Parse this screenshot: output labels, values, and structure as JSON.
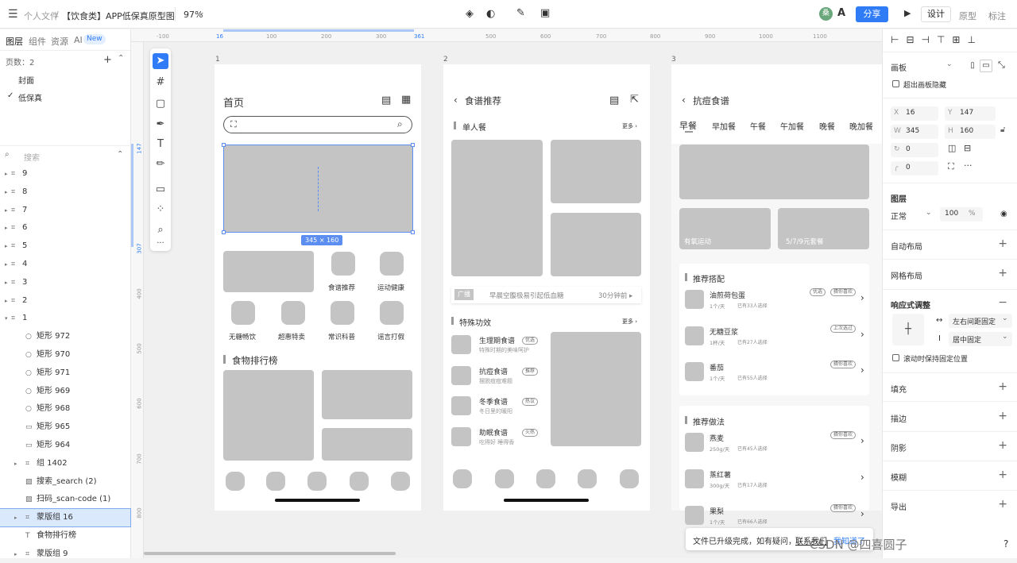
{
  "topbar": {
    "breadcrumb_root": "个人文件",
    "file_title": "【饮食类】APP低保真原型图",
    "zoom": "97%",
    "avatar_text": "桑",
    "share_label": "分享",
    "mode_tabs": [
      "设计",
      "原型",
      "标注"
    ]
  },
  "left_panel": {
    "tabs": [
      "图层",
      "组件",
      "资源",
      "AI"
    ],
    "ai_badge": "New",
    "pages_label": "页数：2",
    "pages": [
      "封面",
      "低保真"
    ],
    "search_placeholder": "搜索",
    "layers": [
      "9",
      "8",
      "7",
      "6",
      "5",
      "4",
      "3",
      "2",
      "1",
      "矩形 972",
      "矩形 970",
      "矩形 971",
      "矩形 969",
      "矩形 968",
      "矩形 965",
      "矩形 964",
      "组 1402",
      "搜索_search (2)",
      "扫码_scan-code (1)",
      "蒙版组 16",
      "食物排行榜",
      "蒙版组 9"
    ]
  },
  "canvas": {
    "ruler_top": [
      "-100",
      "16",
      "100",
      "200",
      "300",
      "361",
      "500",
      "600",
      "700",
      "800",
      "900",
      "1000",
      "1100"
    ],
    "ruler_left": [
      "147",
      "307",
      "400",
      "500",
      "600",
      "700",
      "800"
    ],
    "frame_labels": [
      "1",
      "2",
      "3"
    ],
    "selection_size": "345 × 160",
    "phone1": {
      "title": "首页",
      "icons_row1": [
        "食谱推荐",
        "运动健康"
      ],
      "icons_row2": [
        "无糖畅饮",
        "超惠特卖",
        "常识科普",
        "谣言打假"
      ],
      "section": "食物排行榜"
    },
    "phone2": {
      "title": "食谱推荐",
      "section1": "单人餐",
      "more": "更多",
      "ad_tag": "广播",
      "ad_text": "早晨空腹极易引起低血糖",
      "ad_time": "30分钟前",
      "section2": "特殊功效",
      "items": [
        {
          "name": "生理期食谱",
          "sub": "特殊时期的美味呵护",
          "tag": "优选"
        },
        {
          "name": "抗痘食谱",
          "sub": "摆脱痘痘难题",
          "tag": "推荐"
        },
        {
          "name": "冬季食谱",
          "sub": "冬日里的暖阳",
          "tag": "热议"
        },
        {
          "name": "助眠食谱",
          "sub": "吃得好 睡得香",
          "tag": "火热"
        }
      ]
    },
    "phone3": {
      "title": "抗痘食谱",
      "meal_tabs": [
        "早餐",
        "早加餐",
        "午餐",
        "午加餐",
        "晚餐",
        "晚加餐"
      ],
      "card1": "有氧运动",
      "card2": "5/7/9元套餐",
      "section1": "推荐搭配",
      "pairs": [
        {
          "name": "油煎荷包蛋",
          "qty": "1个/天",
          "count": "已有33人选择",
          "tag": "优选",
          "tag2": "猜你喜欢"
        },
        {
          "name": "无糖豆浆",
          "qty": "1杯/天",
          "count": "已有27人选择",
          "tag": "上次选过"
        },
        {
          "name": "番茄",
          "qty": "1个/天",
          "count": "已有55人选择",
          "tag": "猜你喜欢"
        }
      ],
      "section2": "推荐做法",
      "methods": [
        {
          "name": "燕麦",
          "qty": "250g/天",
          "count": "已有45人选择",
          "tag": "猜你喜欢"
        },
        {
          "name": "蒸红薯",
          "qty": "300g/天",
          "count": "已有17人选择",
          "tag": ""
        },
        {
          "name": "果梨",
          "qty": "1个/天",
          "count": "已有66人选择",
          "tag": "猜你喜欢"
        }
      ]
    },
    "toast_text": "文件已升级完成，如有疑问，",
    "toast_link": "联系我们",
    "toast_ok": "我知道了",
    "watermark": "CSDN @四喜圆子"
  },
  "right_panel": {
    "frame_select": "画板",
    "clip_label": "超出画板隐藏",
    "x": "16",
    "y": "147",
    "w": "345",
    "h": "160",
    "rotation": "0",
    "radius": "0",
    "layer_title": "图层",
    "blend": "正常",
    "opacity": "100",
    "opacity_unit": "%",
    "auto_layout": "自动布局",
    "grid_layout": "网格布局",
    "responsive": "响应式调整",
    "h_constraint": "左右间距固定",
    "v_constraint": "居中固定",
    "scroll_fixed": "滚动时保持固定位置",
    "sections": [
      "填充",
      "描边",
      "阴影",
      "模糊",
      "导出"
    ]
  }
}
